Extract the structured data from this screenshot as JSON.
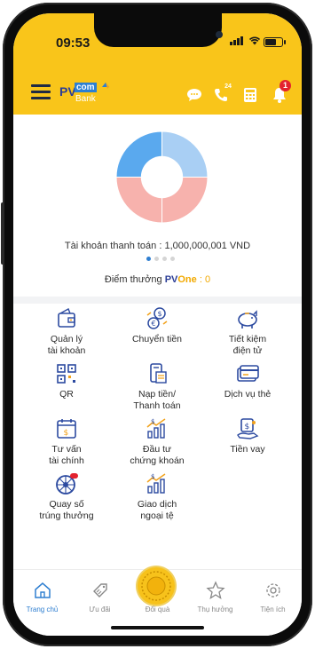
{
  "status_bar": {
    "time": "09:53"
  },
  "header": {
    "brand": {
      "pv": "PV",
      "com": "com",
      "bank": "Bank"
    },
    "notification_count": "1",
    "phone_badge": "24"
  },
  "overview": {
    "account_line": "Tài khoản thanh toán : 1,000,000,001 VND",
    "points_label": "Điểm thưởng",
    "points_brand_pv": "PV",
    "points_brand_one": "One",
    "points_value": ": 0",
    "carousel_pages": 4,
    "carousel_active": 0,
    "chart_colors": [
      "#5aa9ee",
      "#a9cff4",
      "#f7b2ad",
      "#f7b2ad"
    ]
  },
  "services": [
    {
      "label": "Quản lý\ntài khoản",
      "icon": "wallet-icon"
    },
    {
      "label": "Chuyển tiền",
      "icon": "money-transfer-icon"
    },
    {
      "label": "Tiết kiệm\nđiện tử",
      "icon": "piggy-bank-icon"
    },
    {
      "label": "QR",
      "icon": "qr-code-icon"
    },
    {
      "label": "Nạp tiền/\nThanh toán",
      "icon": "bill-payment-icon"
    },
    {
      "label": "Dịch vụ thẻ",
      "icon": "card-icon"
    },
    {
      "label": "Tư vấn\ntài chính",
      "icon": "calendar-money-icon"
    },
    {
      "label": "Đầu tư\nchứng khoán",
      "icon": "stock-chart-icon"
    },
    {
      "label": "Tiền vay",
      "icon": "loan-icon"
    },
    {
      "label": "Quay số\ntrúng thưởng",
      "icon": "lucky-wheel-icon"
    },
    {
      "label": "Giao dịch\nngoại tệ",
      "icon": "forex-icon"
    }
  ],
  "tabs": [
    {
      "label": "Trang chủ",
      "icon": "home-icon",
      "active": true
    },
    {
      "label": "Ưu đãi",
      "icon": "gift-tag-icon",
      "active": false
    },
    {
      "label": "Đổi quà",
      "icon": "exchange-gift-icon",
      "active": false
    },
    {
      "label": "Thụ hưởng",
      "icon": "star-icon",
      "active": false
    },
    {
      "label": "Tiện ích",
      "icon": "settings-icon",
      "active": false
    }
  ]
}
